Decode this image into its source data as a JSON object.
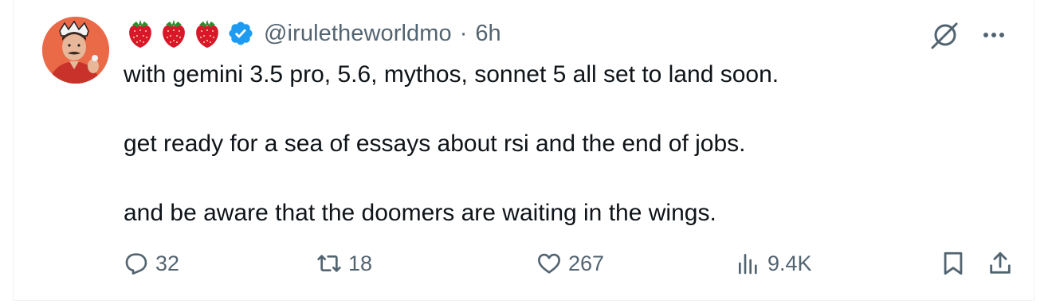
{
  "tweet": {
    "handle": "@iruletheworldmo",
    "separator": "·",
    "time": "6h",
    "badges": [
      "strawberry-emoji",
      "strawberry-emoji",
      "strawberry-emoji",
      "verified-badge"
    ],
    "lines": [
      "with gemini 3.5 pro, 5.6, mythos, sonnet 5 all set to land soon.",
      "get ready for a sea of essays about rsi and the end of jobs.",
      "and be aware that the doomers are waiting in the wings."
    ],
    "stats": {
      "replies": "32",
      "reposts": "18",
      "likes": "267",
      "views": "9.4K"
    }
  },
  "colors": {
    "text": "#0f1419",
    "muted": "#536471",
    "verified": "#1d9bf0",
    "border": "#eff3f4"
  },
  "icons": {
    "reply": "reply-icon",
    "repost": "repost-icon",
    "like": "heart-icon",
    "views": "views-icon",
    "bookmark": "bookmark-icon",
    "share": "share-icon",
    "grok": "grok-icon",
    "more": "more-icon"
  }
}
